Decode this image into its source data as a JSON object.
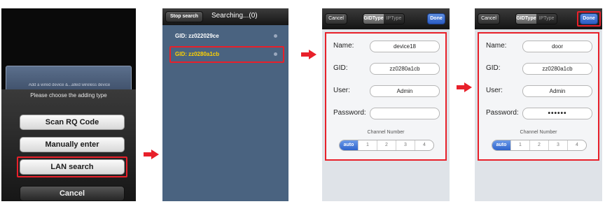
{
  "screen1": {
    "ghost_text": "Add a wired device &...alled wireless device",
    "sheet_title": "Please choose the adding type",
    "buttons": [
      "Scan RQ Code",
      "Manually enter",
      "LAN search"
    ],
    "cancel": "Cancel"
  },
  "screen2": {
    "stop_label": "Stop search",
    "title": "Searching...(0)",
    "items": [
      {
        "gid": "GID: zz022029ce",
        "color": "#ffffff"
      },
      {
        "gid": "GID: zz0280a1cb",
        "color": "#ffd200"
      }
    ]
  },
  "screen3": {
    "cancel": "Cancel",
    "tab_gid": "GIDType",
    "tab_ip": "IPType",
    "done": "Done",
    "labels": {
      "name": "Name:",
      "gid": "GID:",
      "user": "User:",
      "password": "Password:"
    },
    "values": {
      "name": "device18",
      "gid": "zz0280a1cb",
      "user": "Admin",
      "password": ""
    },
    "channel_title": "Channel Number",
    "channels": [
      "auto",
      "1",
      "2",
      "3",
      "4"
    ]
  },
  "screen4": {
    "cancel": "Cancel",
    "tab_gid": "GIDType",
    "tab_ip": "IPType",
    "done": "Done",
    "labels": {
      "name": "Name:",
      "gid": "GID:",
      "user": "User:",
      "password": "Password:"
    },
    "values": {
      "name": "door",
      "gid": "zz0280a1cb",
      "user": "Admin",
      "password": "••••••"
    },
    "channel_title": "Channel Number",
    "channels": [
      "auto",
      "1",
      "2",
      "3",
      "4"
    ]
  },
  "colors": {
    "highlight": "#e8202a",
    "selected_gid": "#ffd200",
    "accent_blue": "#2f64cc"
  }
}
